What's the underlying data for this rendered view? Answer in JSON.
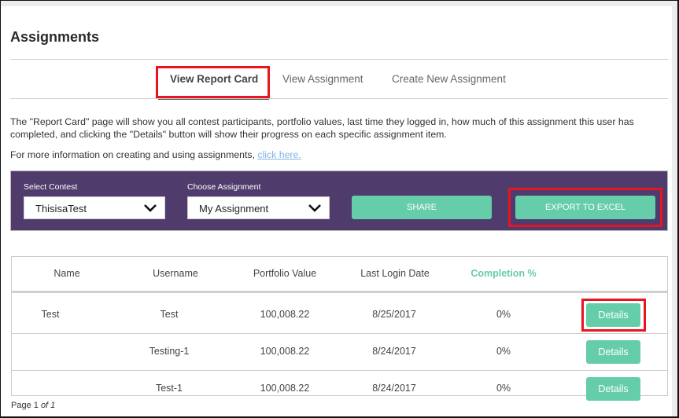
{
  "page": {
    "title": "Assignments"
  },
  "tabs": [
    {
      "label": "View Report Card",
      "active": true
    },
    {
      "label": "View Assignment",
      "active": false
    },
    {
      "label": "Create New Assignment",
      "active": false
    }
  ],
  "description": "The \"Report Card\" page will show you all contest participants, portfolio values, last time they logged in, how much of this assignment this user has completed, and clicking the \"Details\" button will show their progress on each specific assignment item.",
  "more_info": {
    "text": "For more information on creating and using assignments, ",
    "link_label": "click here."
  },
  "controls": {
    "contest_label": "Select Contest",
    "contest_value": "ThisisaTest",
    "assignment_label": "Choose Assignment",
    "assignment_value": "My Assignment",
    "share_label": "SHARE",
    "export_label": "EXPORT TO EXCEL"
  },
  "table": {
    "columns": [
      "Name",
      "Username",
      "Portfolio Value",
      "Last Login Date",
      "Completion %"
    ],
    "details_label": "Details",
    "rows": [
      {
        "name": "Test",
        "username": "Test",
        "portfolio": "100,008.22",
        "last_login": "8/25/2017",
        "completion": "0%"
      },
      {
        "name": "",
        "username": "Testing-1",
        "portfolio": "100,008.22",
        "last_login": "8/24/2017",
        "completion": "0%"
      },
      {
        "name": "",
        "username": "Test-1",
        "portfolio": "100,008.22",
        "last_login": "8/24/2017",
        "completion": "0%"
      }
    ]
  },
  "pager": {
    "page_label": "Page 1",
    "of_label": "of 1"
  },
  "colors": {
    "accent_green": "#66cdaa",
    "panel_purple": "#4f3c6d",
    "highlight_red": "#e8141f",
    "link_blue": "#7fb3e8"
  }
}
